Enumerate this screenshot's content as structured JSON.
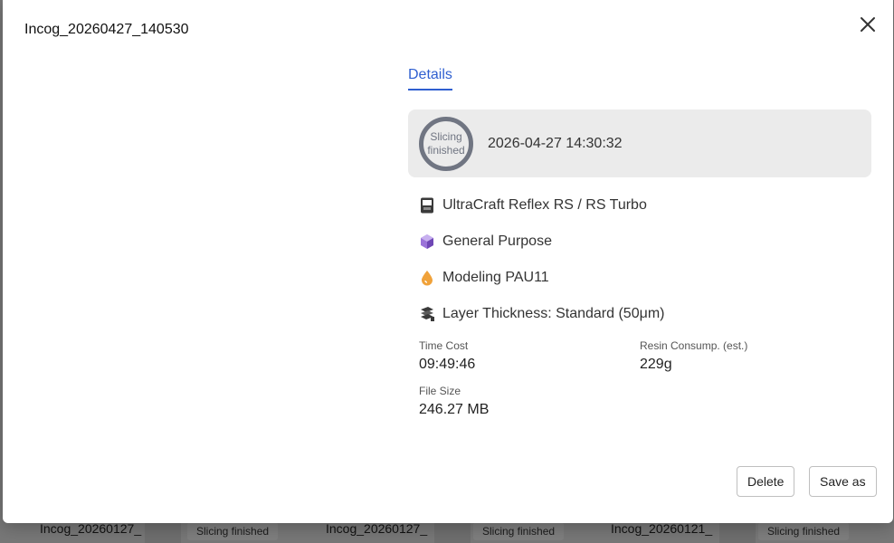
{
  "modal": {
    "title": "Incog_20260427_140530",
    "tab_details": "Details",
    "status": {
      "line1": "Slicing",
      "line2": "finished",
      "timestamp": "2026-04-27 14:30:32",
      "ring_color": "#707582"
    },
    "info": [
      {
        "icon": "printer-icon",
        "text": "UltraCraft Reflex RS / RS Turbo"
      },
      {
        "icon": "cube-icon",
        "text": "General Purpose"
      },
      {
        "icon": "resin-drop-icon",
        "text": "Modeling PAU11"
      },
      {
        "icon": "layers-icon",
        "text": "Layer Thickness: Standard (50μm)"
      }
    ],
    "stats": {
      "time_cost_label": "Time Cost",
      "time_cost_value": "09:49:46",
      "resin_label": "Resin Consump. (est.)",
      "resin_value": "229g",
      "file_size_label": "File Size",
      "file_size_value": "246.27 MB"
    },
    "buttons": {
      "delete": "Delete",
      "save_as": "Save as"
    },
    "accent_color": "#2f5fd0"
  },
  "background_cards": [
    {
      "name": "Incog_20260127_",
      "badge": "Slicing finished"
    },
    {
      "name": "Incog_20260127_",
      "badge": "Slicing finished"
    },
    {
      "name": "Incog_20260121_",
      "badge": "Slicing finished"
    }
  ]
}
